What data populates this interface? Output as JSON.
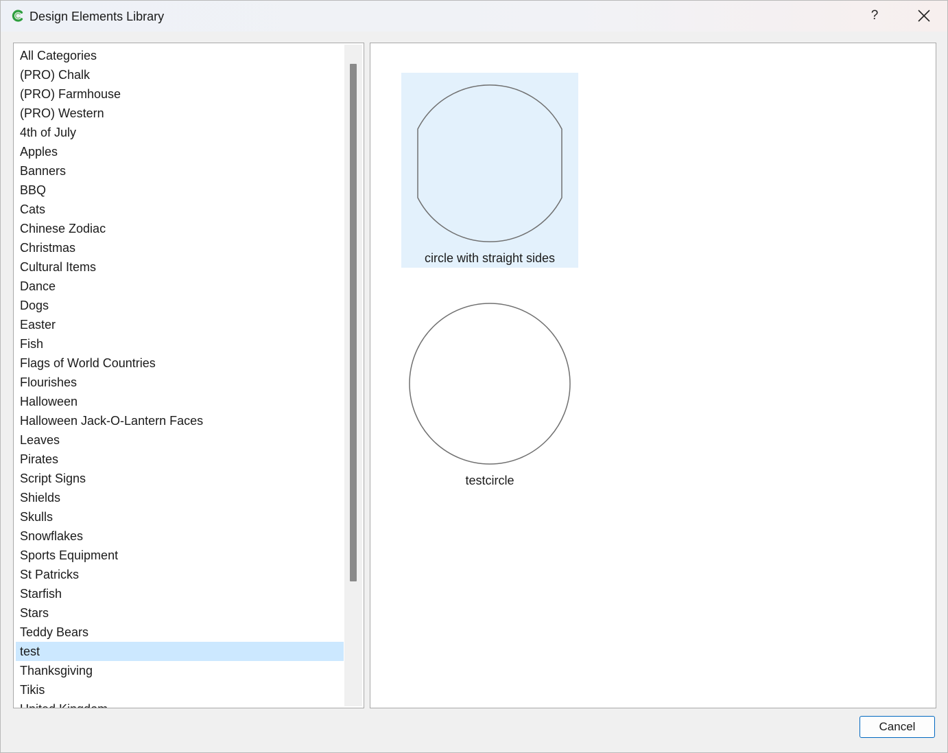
{
  "window": {
    "title": "Design Elements Library",
    "help_label": "?",
    "accent_color": "#0067c0",
    "selection_color": "#cce8ff"
  },
  "categories": {
    "items": [
      {
        "label": "All Categories",
        "selected": false
      },
      {
        "label": "(PRO) Chalk",
        "selected": false
      },
      {
        "label": "(PRO) Farmhouse",
        "selected": false
      },
      {
        "label": "(PRO) Western",
        "selected": false
      },
      {
        "label": "4th of July",
        "selected": false
      },
      {
        "label": "Apples",
        "selected": false
      },
      {
        "label": "Banners",
        "selected": false
      },
      {
        "label": "BBQ",
        "selected": false
      },
      {
        "label": "Cats",
        "selected": false
      },
      {
        "label": "Chinese Zodiac",
        "selected": false
      },
      {
        "label": "Christmas",
        "selected": false
      },
      {
        "label": "Cultural Items",
        "selected": false
      },
      {
        "label": "Dance",
        "selected": false
      },
      {
        "label": "Dogs",
        "selected": false
      },
      {
        "label": "Easter",
        "selected": false
      },
      {
        "label": "Fish",
        "selected": false
      },
      {
        "label": "Flags of World Countries",
        "selected": false
      },
      {
        "label": "Flourishes",
        "selected": false
      },
      {
        "label": "Halloween",
        "selected": false
      },
      {
        "label": "Halloween Jack-O-Lantern Faces",
        "selected": false
      },
      {
        "label": "Leaves",
        "selected": false
      },
      {
        "label": "Pirates",
        "selected": false
      },
      {
        "label": "Script Signs",
        "selected": false
      },
      {
        "label": "Shields",
        "selected": false
      },
      {
        "label": "Skulls",
        "selected": false
      },
      {
        "label": "Snowflakes",
        "selected": false
      },
      {
        "label": "Sports Equipment",
        "selected": false
      },
      {
        "label": "St Patricks",
        "selected": false
      },
      {
        "label": "Starfish",
        "selected": false
      },
      {
        "label": "Stars",
        "selected": false
      },
      {
        "label": "Teddy Bears",
        "selected": false
      },
      {
        "label": "test",
        "selected": true
      },
      {
        "label": "Thanksgiving",
        "selected": false
      },
      {
        "label": "Tikis",
        "selected": false
      },
      {
        "label": "United Kingdom",
        "selected": false
      }
    ]
  },
  "elements": [
    {
      "label": "circle with straight sides",
      "shape": "circle-flat-sides-icon",
      "selected": true
    },
    {
      "label": "testcircle",
      "shape": "circle-icon",
      "selected": false
    }
  ],
  "footer": {
    "cancel_label": "Cancel"
  }
}
